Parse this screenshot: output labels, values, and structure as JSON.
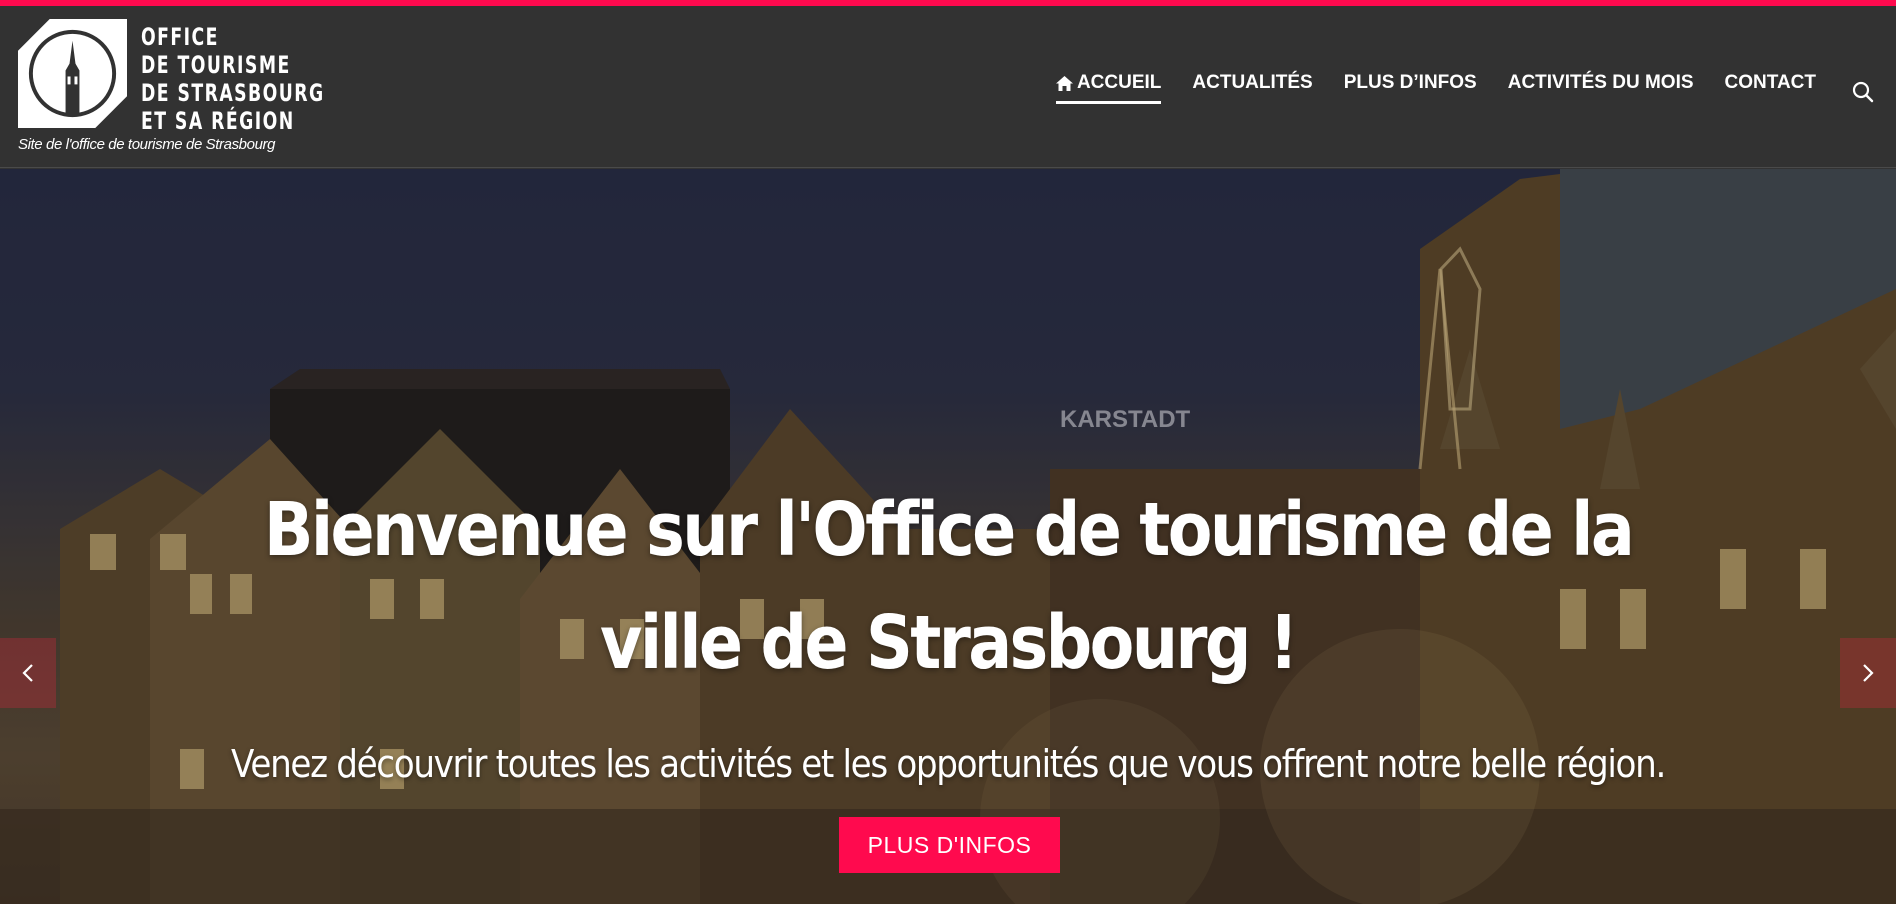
{
  "header": {
    "logo_lines": [
      "OFFICE",
      "DE TOURISME",
      "DE STRASBOURG",
      "ET SA RÉGION"
    ],
    "tagline": "Site de l'office de tourisme de Strasbourg"
  },
  "nav": {
    "items": [
      {
        "label": "ACCUEIL",
        "icon": "home-icon",
        "active": true
      },
      {
        "label": "ACTUALITÉS",
        "active": false
      },
      {
        "label": "PLUS D’INFOS",
        "active": false
      },
      {
        "label": "ACTIVITÉS DU MOIS",
        "active": false
      },
      {
        "label": "CONTACT",
        "active": false
      }
    ],
    "search_icon": "search-icon"
  },
  "hero": {
    "title": "Bienvenue sur l'Office de tourisme de la ville de Strasbourg !",
    "subtitle": "Venez découvrir toutes les activités et les opportunités que vous offrent notre belle région.",
    "cta_label": "PLUS D'INFOS",
    "prev_icon": "chevron-left-icon",
    "next_icon": "chevron-right-icon"
  },
  "colors": {
    "accent": "#ff0a4e",
    "header_bg": "#323232"
  }
}
